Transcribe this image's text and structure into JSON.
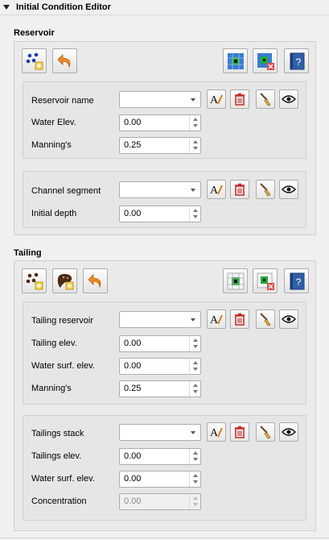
{
  "panel": {
    "title": "Initial Condition Editor"
  },
  "reservoir": {
    "title": "Reservoir",
    "toolbar": {
      "left": [
        "add-points-icon",
        "undo-icon"
      ],
      "right": [
        "grid-cells-icon",
        "grid-cells-delete-icon",
        "help-book-icon"
      ]
    },
    "reservoir_group": {
      "name_label": "Reservoir name",
      "name_value": "",
      "water_elev_label": "Water Elev.",
      "water_elev_value": "0.00",
      "mannings_label": "Manning's",
      "mannings_value": "0.25"
    },
    "channel_group": {
      "segment_label": "Channel segment",
      "segment_value": "",
      "depth_label": "Initial depth",
      "depth_value": "0.00"
    }
  },
  "tailing": {
    "title": "Tailing",
    "toolbar": {
      "left": [
        "add-points-icon",
        "tailing-polygon-icon",
        "undo-icon"
      ],
      "right": [
        "grid-cells-icon",
        "grid-cells-delete-icon",
        "help-book-icon"
      ]
    },
    "reservoir_group": {
      "reservoir_label": "Tailing reservoir",
      "reservoir_value": "",
      "elev_label": "Tailing elev.",
      "elev_value": "0.00",
      "water_label": "Water surf. elev.",
      "water_value": "0.00",
      "mannings_label": "Manning's",
      "mannings_value": "0.25"
    },
    "stack_group": {
      "stack_label": "Tailings stack",
      "stack_value": "",
      "elev_label": "Tailings elev.",
      "elev_value": "0.00",
      "water_label": "Water surf. elev.",
      "water_value": "0.00",
      "conc_label": "Concentration",
      "conc_value": "0.00"
    }
  },
  "row_actions": [
    "rename-icon",
    "delete-icon",
    "brush-icon",
    "eye-icon"
  ],
  "colors": {
    "background": "#f0f0f0",
    "delete_red": "#c62828",
    "help_blue": "#2f5fa8",
    "cell_green": "#1faa3c",
    "grid_blue": "#3b7bd4"
  }
}
